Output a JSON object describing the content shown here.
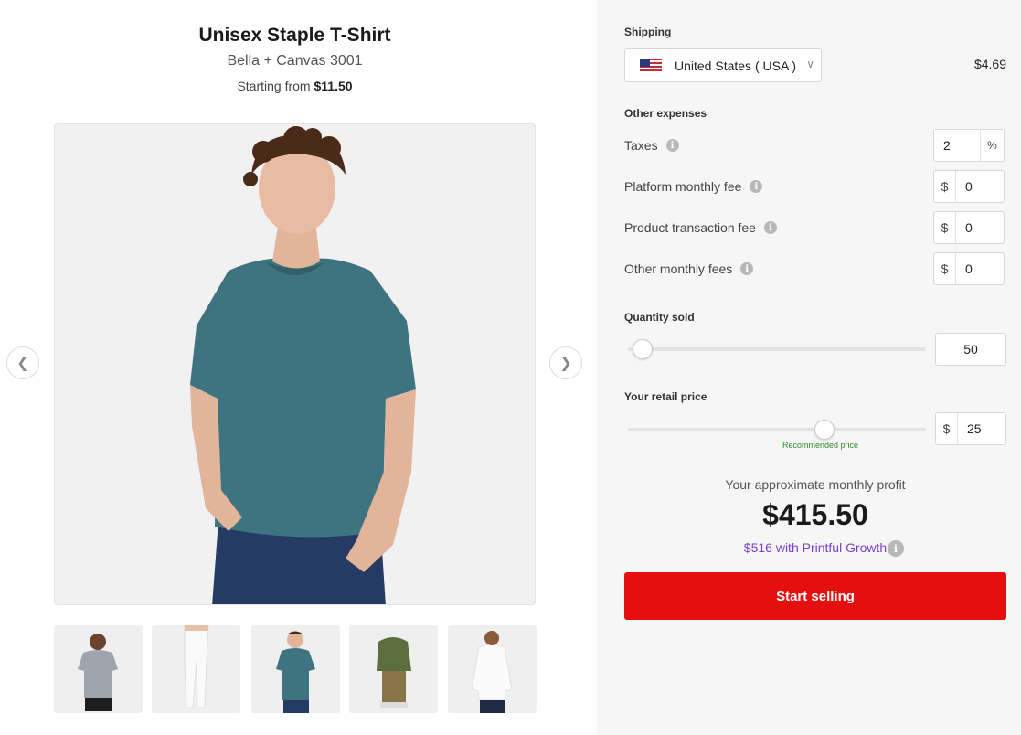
{
  "product": {
    "title": "Unisex Staple T-Shirt",
    "brand": "Bella + Canvas 3001",
    "price_prefix": "Starting from",
    "price": "$11.50"
  },
  "gallery": {
    "thumbnails": [
      "gray-tshirt-model",
      "white-leggings-model",
      "teal-tshirt-model",
      "olive-hoodie-model",
      "white-longsleeve-model"
    ],
    "active_index": 2
  },
  "colors": {
    "accent": "#e60f0f",
    "growth": "#7a3fd0",
    "recommended": "#2c8a2c",
    "shirt": "#3e7480"
  },
  "shipping": {
    "label": "Shipping",
    "country": "United States ( USA )",
    "price": "$4.69"
  },
  "expenses": {
    "label": "Other expenses",
    "taxes": {
      "label": "Taxes",
      "value": "2",
      "unit": "%"
    },
    "platform_fee": {
      "label": "Platform monthly fee",
      "prefix": "$",
      "value": "0"
    },
    "transaction_fee": {
      "label": "Product transaction fee",
      "prefix": "$",
      "value": "0"
    },
    "other_fees": {
      "label": "Other monthly fees",
      "prefix": "$",
      "value": "0"
    }
  },
  "quantity": {
    "label": "Quantity sold",
    "value": "50",
    "slider_fraction": 0.05
  },
  "retail": {
    "label": "Your retail price",
    "prefix": "$",
    "value": "25",
    "slider_fraction": 0.66,
    "recommended_label": "Recommended price"
  },
  "profit": {
    "caption": "Your approximate monthly profit",
    "value": "$415.50",
    "growth_text": "$516 with Printful Growth"
  },
  "cta": {
    "label": "Start selling"
  }
}
